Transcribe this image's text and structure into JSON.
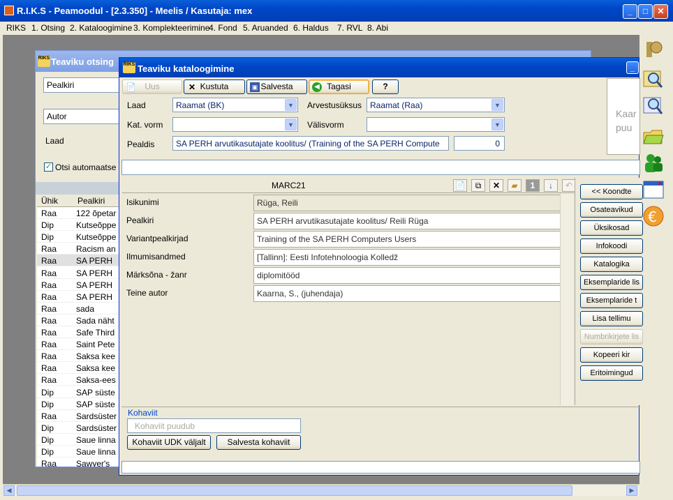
{
  "app": {
    "title": "R.I.K.S - Peamoodul - [2.3.350] - Meelis / Kasutaja: mex",
    "menu": [
      "RIKS",
      "1. Otsing",
      "2. Kataloogimine",
      "3. Komplekteerimine",
      "4. Fond",
      "5. Aruanded",
      "6. Haldus",
      "7. RVL",
      "8. Abi"
    ]
  },
  "search_window": {
    "title": "Teaviku otsing",
    "field1": "Pealkiri",
    "field2": "Autor",
    "laad_label": "Laad",
    "auto_search_label": "Otsi automaatse",
    "columns": [
      "Ühik",
      "Pealkiri"
    ],
    "rows": [
      [
        "Raa",
        "122 õpetar"
      ],
      [
        "Dip",
        "Kutseõppe"
      ],
      [
        "Dip",
        "Kutseõppe"
      ],
      [
        "Raa",
        "Racism an"
      ],
      [
        "Raa",
        "SA PERH"
      ],
      [
        "Raa",
        "SA PERH"
      ],
      [
        "Raa",
        "SA PERH"
      ],
      [
        "Raa",
        "SA PERH"
      ],
      [
        "Raa",
        "sada"
      ],
      [
        "Raa",
        "Sada näht"
      ],
      [
        "Raa",
        "Safe Third"
      ],
      [
        "Raa",
        "Saint Pete"
      ],
      [
        "Raa",
        "Saksa kee"
      ],
      [
        "Raa",
        "Saksa kee"
      ],
      [
        "Raa",
        "Saksa-ees"
      ],
      [
        "Dip",
        "SAP süste"
      ],
      [
        "Dip",
        "SAP süste"
      ],
      [
        "Raa",
        "Sardsüster"
      ],
      [
        "Dip",
        "Sardsüster"
      ],
      [
        "Dip",
        "Saue linna"
      ],
      [
        "Dip",
        "Saue linna"
      ],
      [
        "Raa",
        "Sawyer's"
      ]
    ]
  },
  "catalog_window": {
    "title": "Teaviku kataloogimine",
    "toolbar": {
      "new_label": "Uus",
      "delete_label": "Kustuta",
      "save_label": "Salvesta",
      "back_label": "Tagasi",
      "help_label": "?"
    },
    "form": {
      "laad_label": "Laad",
      "laad_value": "Raamat (BK)",
      "arvestus_label": "Arvestusüksus",
      "arvestus_value": "Raamat (Raa)",
      "katvorm_label": "Kat. vorm",
      "katvorm_value": "",
      "valisvorm_label": "Välisvorm",
      "valisvorm_value": "",
      "pealdis_label": "Pealdis",
      "pealdis_value": "SA PERH arvutikasutajate koolitus/ (Training of the SA PERH Compute",
      "count_value": "0"
    },
    "preview_text": "Kaar puu",
    "marc_header": "MARC21",
    "marc_rows": [
      {
        "label": "Isikunimi",
        "value": "Rüga, Reili"
      },
      {
        "label": "Pealkiri",
        "value": "SA PERH arvutikasutajate koolitus/ Reili Rüga"
      },
      {
        "label": "Variantpealkirjad",
        "value": "Training of the SA PERH Computers Users"
      },
      {
        "label": "Ilmumisandmed",
        "value": "[Tallinn]: Eesti Infotehnoloogia Kolledž"
      },
      {
        "label": "Märksõna - žanr",
        "value": "diplomitööd"
      },
      {
        "label": "Teine autor",
        "value": "Kaarna, S., (juhendaja)"
      }
    ],
    "side_buttons": [
      {
        "label": "<< Koondte",
        "enabled": true
      },
      {
        "label": "Osateavikud",
        "enabled": true
      },
      {
        "label": "Üksikosad",
        "enabled": true
      },
      {
        "label": "Infokoodi",
        "enabled": true
      },
      {
        "label": "Katalogika",
        "enabled": true
      },
      {
        "label": "Eksemplaride lis",
        "enabled": true
      },
      {
        "label": "Eksemplaride t",
        "enabled": true
      },
      {
        "label": "Lisa tellimu",
        "enabled": true
      },
      {
        "label": "Numbrikirjete lis",
        "enabled": false
      },
      {
        "label": "Kopeeri kir",
        "enabled": true
      },
      {
        "label": "Eritoimingud",
        "enabled": true
      }
    ],
    "kohaviit": {
      "group_label": "Kohaviit",
      "placeholder": "Kohaviit puudub",
      "udk_button": "Kohaviit UDK väljalt",
      "save_button": "Salvesta kohaviit"
    }
  }
}
